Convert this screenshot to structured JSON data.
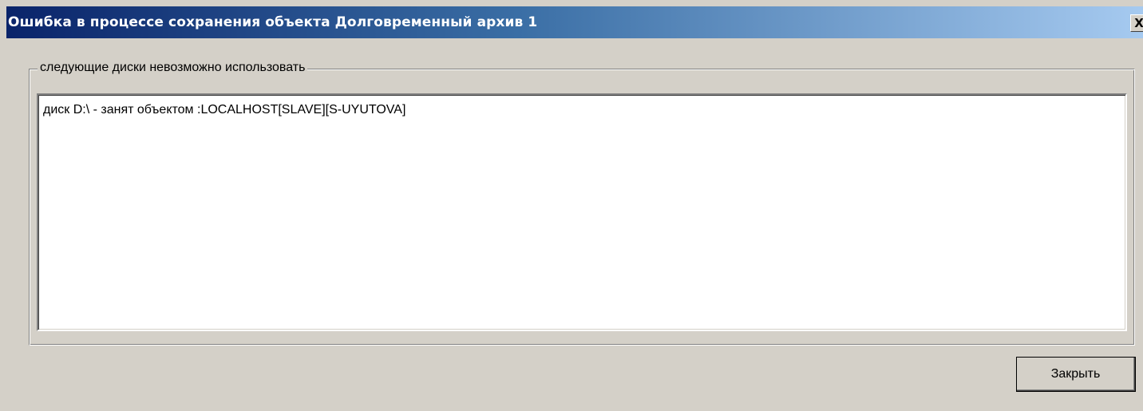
{
  "window": {
    "title": "Ошибка в процессе сохранения объекта Долговременный архив 1",
    "close_glyph": "X"
  },
  "group": {
    "label": "следующие диски невозможно использовать",
    "items": [
      "диск D:\\ - занят объектом :LOCALHOST[SLAVE][S-UYUTOVA]"
    ]
  },
  "buttons": {
    "close_label": "Закрыть"
  },
  "colors": {
    "title_start": "#0a246a",
    "title_end": "#a6caf0",
    "face": "#d4d0c8"
  }
}
